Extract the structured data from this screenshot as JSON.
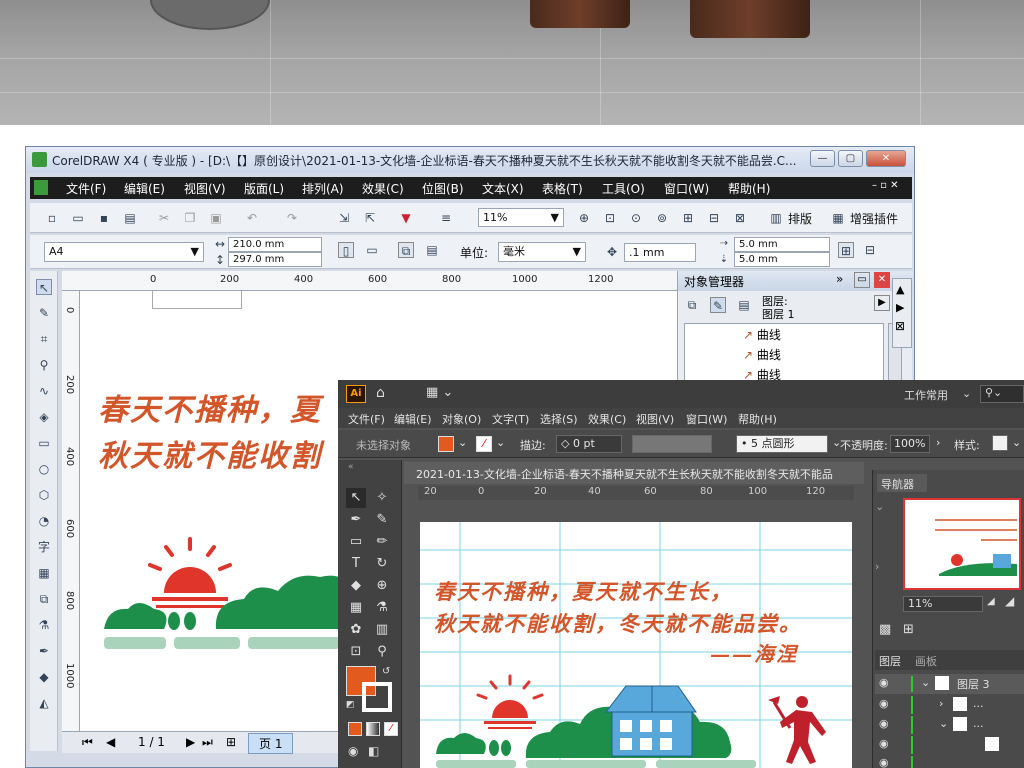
{
  "corel": {
    "title": "CorelDRAW X4 ( 专业版 ) - [D:\\【】原创设计\\2021-01-13-文化墙-企业标语-春天不播种夏天就不生长秋天就不能收割冬天就不能品尝.C...",
    "window_buttons": [
      "—",
      "▢",
      "✕"
    ],
    "menu": [
      "文件(F)",
      "编辑(E)",
      "视图(V)",
      "版面(L)",
      "排列(A)",
      "效果(C)",
      "位图(B)",
      "文本(X)",
      "表格(T)",
      "工具(O)",
      "窗口(W)",
      "帮助(H)"
    ],
    "zoom": "11%",
    "paibain": "排版",
    "plugin": "增强插件",
    "paper_size": "A4",
    "width": "210.0 mm",
    "height": "297.0 mm",
    "unit_label": "单位:",
    "unit_value": "毫米",
    "nudge": ".1 mm",
    "dup_x": "5.0 mm",
    "dup_y": "5.0 mm",
    "ruler_h": [
      "0",
      "200",
      "400",
      "600",
      "800",
      "1000",
      "1200"
    ],
    "ruler_v": [
      "0",
      "200",
      "400",
      "600",
      "800",
      "1000"
    ],
    "page_nav": "1 / 1",
    "page_tab": "页 1",
    "slogan_line1": "春天不播种，夏",
    "slogan_line2": "秋天就不能收割",
    "objmgr": {
      "title": "对象管理器",
      "layer_header": "图层:",
      "layer_name": "图层 1",
      "items": [
        "曲线",
        "曲线",
        "曲线"
      ]
    }
  },
  "ai": {
    "logo": "Ai",
    "workspace": "工作常用",
    "menu": [
      "文件(F)",
      "编辑(E)",
      "对象(O)",
      "文字(T)",
      "选择(S)",
      "效果(C)",
      "视图(V)",
      "窗口(W)",
      "帮助(H)"
    ],
    "no_selection": "未选择对象",
    "stroke_label": "描边:",
    "stroke_value": "0 pt",
    "brush": "5 点圆形",
    "opacity_label": "不透明度:",
    "opacity_value": "100%",
    "style_label": "样式:",
    "doc_tab": "2021-01-13-文化墙-企业标语-春天不播种夏天就不生长秋天就不能收割冬天就不能品",
    "ruler": [
      "20",
      "0",
      "20",
      "40",
      "60",
      "80",
      "100",
      "120"
    ],
    "slogan_line1": "春天不播种，夏天就不生长，",
    "slogan_line2": "秋天就不能收割，冬天就不能品尝。",
    "signature": "——海涅",
    "navigator": {
      "title": "导航器",
      "zoom": "11%"
    },
    "layers": {
      "tab1": "图层",
      "tab2": "画板",
      "layer_name": "图层 3",
      "sub": [
        "...",
        "..."
      ]
    }
  },
  "colors": {
    "red_orange": "#d3552a",
    "green": "#1e8f4a",
    "light_green": "#a9d4bb",
    "blue": "#58a8dc",
    "ai_fill": "#e35a1e"
  }
}
